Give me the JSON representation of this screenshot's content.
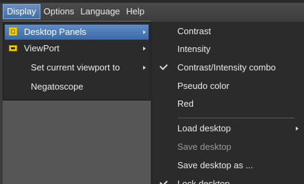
{
  "menubar": {
    "items": [
      {
        "label": "Display",
        "active": true
      },
      {
        "label": "Options",
        "active": false
      },
      {
        "label": "Language",
        "active": false
      },
      {
        "label": "Help",
        "active": false
      }
    ]
  },
  "display_menu": {
    "items": [
      {
        "label": "Desktop Panels",
        "icon": "folder-icon",
        "submenu": true,
        "selected": true
      },
      {
        "label": "ViewPort",
        "icon": "monitor-icon",
        "submenu": true
      },
      {
        "label": "Set current viewport to",
        "submenu": true
      },
      {
        "label": "Negatoscope"
      }
    ]
  },
  "desktop_panels_menu": {
    "items": [
      {
        "label": "Contrast"
      },
      {
        "label": "Intensity"
      },
      {
        "label": "Contrast/Intensity combo",
        "checked": true
      },
      {
        "label": "Pseudo color"
      },
      {
        "label": "Red"
      },
      {
        "label": "Load desktop",
        "submenu": true
      },
      {
        "label": "Save desktop",
        "disabled": true
      },
      {
        "label": "Save desktop as ..."
      },
      {
        "label": "Lock desktop",
        "checked": true
      }
    ]
  },
  "colors": {
    "selection": "#3f6fa8",
    "menu_bg": "#2b2b2b",
    "icon": "#f3d000"
  }
}
